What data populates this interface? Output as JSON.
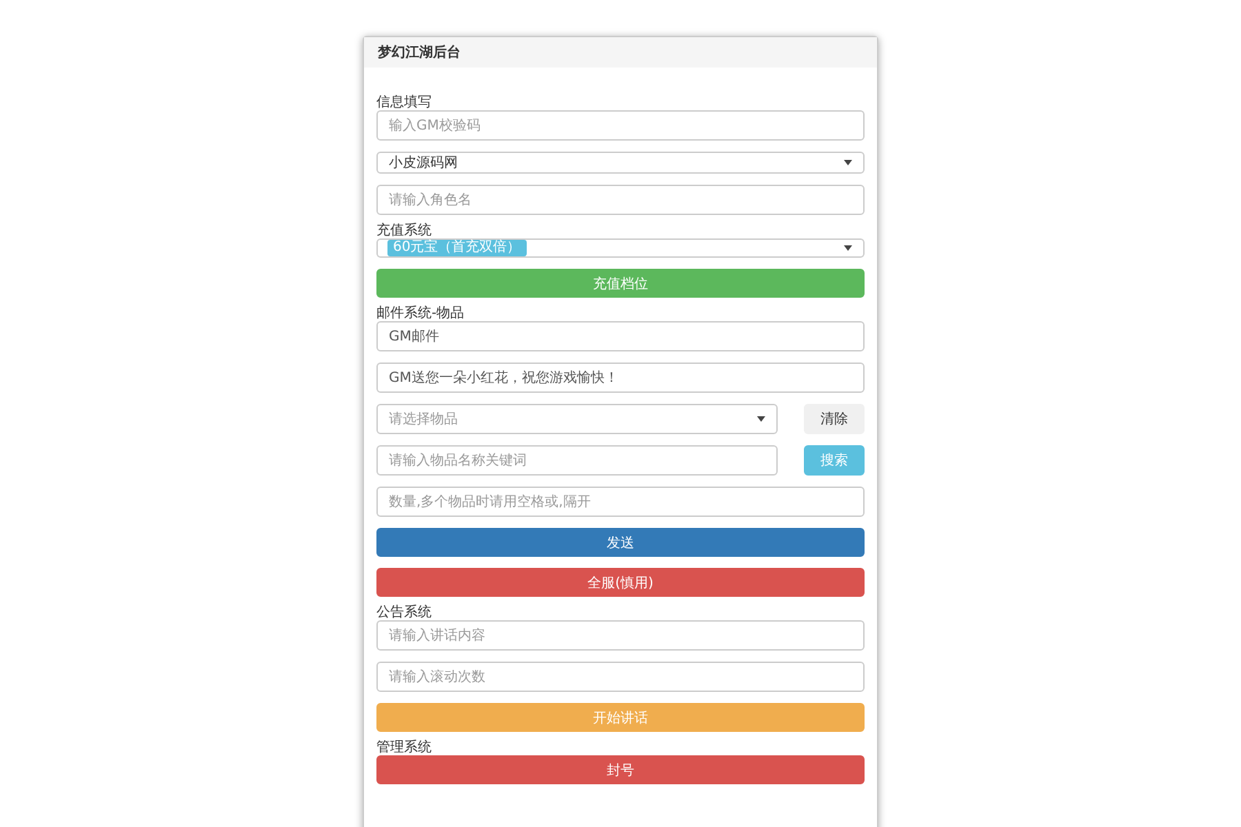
{
  "panel": {
    "title": "梦幻江湖后台"
  },
  "sections": [
    {
      "label": "信息填写",
      "items": [
        {
          "kind": "input",
          "placeholder": "输入GM校验码"
        },
        {
          "kind": "select",
          "value": "小皮源码网"
        },
        {
          "kind": "input",
          "placeholder": "请输入角色名"
        }
      ]
    },
    {
      "label": "充值系统",
      "items": [
        {
          "kind": "tag-select",
          "tag": "60元宝（首充双倍）"
        },
        {
          "kind": "button",
          "label": "充值档位",
          "color": "#5cb85c"
        }
      ]
    },
    {
      "label": "邮件系统-物品",
      "items": [
        {
          "kind": "input",
          "value": "GM邮件"
        },
        {
          "kind": "input",
          "value": "GM送您一朵小红花，祝您游戏愉快！"
        },
        {
          "kind": "select-action",
          "placeholder": "请选择物品",
          "button": "清除",
          "color": "#f0f0f0"
        },
        {
          "kind": "input-action",
          "placeholder": "请输入物品名称关键词",
          "button": "搜索",
          "color": "#5bc0de"
        },
        {
          "kind": "input",
          "placeholder": "数量,多个物品时请用空格或,隔开"
        },
        {
          "kind": "button",
          "label": "发送",
          "color": "#337ab7"
        },
        {
          "kind": "button",
          "label": "全服(慎用)",
          "color": "#d9534f"
        }
      ]
    },
    {
      "label": "公告系统",
      "items": [
        {
          "kind": "input",
          "placeholder": "请输入讲话内容"
        },
        {
          "kind": "input",
          "placeholder": "请输入滚动次数"
        },
        {
          "kind": "button",
          "label": "开始讲话",
          "color": "#f0ad4e"
        }
      ]
    },
    {
      "label": "管理系统",
      "items": [
        {
          "kind": "button",
          "label": "封号",
          "color": "#d9534f"
        }
      ]
    }
  ]
}
